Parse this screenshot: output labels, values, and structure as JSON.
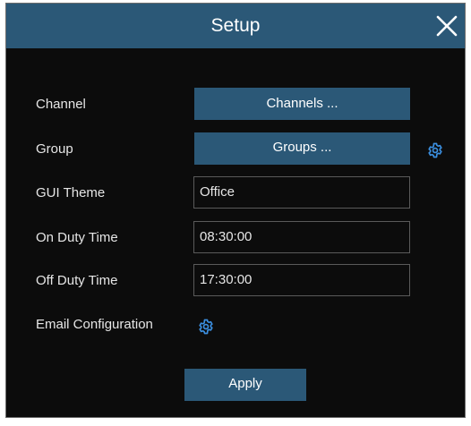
{
  "dialog": {
    "title": "Setup",
    "close_icon": "close-icon"
  },
  "rows": {
    "channel": {
      "label": "Channel",
      "button_label": "Channels ..."
    },
    "group": {
      "label": "Group",
      "button_label": "Groups ...",
      "settings_icon": "gear-icon"
    },
    "gui_theme": {
      "label": "GUI Theme",
      "value": "Office"
    },
    "on_duty_time": {
      "label": "On Duty Time",
      "value": "08:30:00"
    },
    "off_duty_time": {
      "label": "Off Duty Time",
      "value": "17:30:00"
    },
    "email_configuration": {
      "label": "Email Configuration",
      "settings_icon": "gear-icon"
    }
  },
  "actions": {
    "apply_label": "Apply"
  },
  "colors": {
    "accent": "#2b5877",
    "background": "#0c0c0c",
    "icon_blue": "#3b8fe0",
    "text": "#e6e6e6"
  }
}
